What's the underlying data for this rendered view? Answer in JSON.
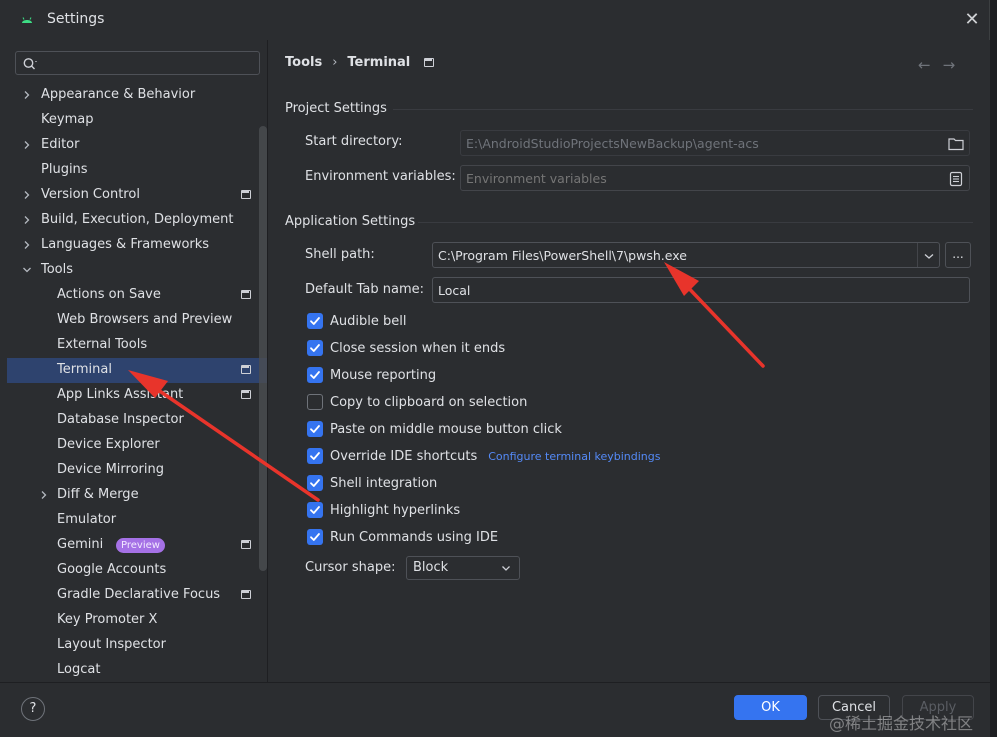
{
  "window": {
    "title": "Settings",
    "close_label": "✕"
  },
  "search": {
    "placeholder": "",
    "value": ""
  },
  "sidebar": {
    "items": [
      {
        "label": "Appearance & Behavior",
        "level": 0,
        "expandable": true,
        "expanded": false,
        "project": false
      },
      {
        "label": "Keymap",
        "level": 0,
        "expandable": false,
        "project": false
      },
      {
        "label": "Editor",
        "level": 0,
        "expandable": true,
        "expanded": false,
        "project": false
      },
      {
        "label": "Plugins",
        "level": 0,
        "expandable": false,
        "project": false
      },
      {
        "label": "Version Control",
        "level": 0,
        "expandable": true,
        "expanded": false,
        "project": true
      },
      {
        "label": "Build, Execution, Deployment",
        "level": 0,
        "expandable": true,
        "expanded": false,
        "project": false
      },
      {
        "label": "Languages & Frameworks",
        "level": 0,
        "expandable": true,
        "expanded": false,
        "project": false
      },
      {
        "label": "Tools",
        "level": 0,
        "expandable": true,
        "expanded": true,
        "project": false
      },
      {
        "label": "Actions on Save",
        "level": 1,
        "expandable": false,
        "project": true
      },
      {
        "label": "Web Browsers and Preview",
        "level": 1,
        "expandable": false,
        "project": false
      },
      {
        "label": "External Tools",
        "level": 1,
        "expandable": false,
        "project": false
      },
      {
        "label": "Terminal",
        "level": 1,
        "expandable": false,
        "project": true,
        "selected": true
      },
      {
        "label": "App Links Assistant",
        "level": 1,
        "expandable": false,
        "project": true
      },
      {
        "label": "Database Inspector",
        "level": 1,
        "expandable": false,
        "project": false
      },
      {
        "label": "Device Explorer",
        "level": 1,
        "expandable": false,
        "project": false
      },
      {
        "label": "Device Mirroring",
        "level": 1,
        "expandable": false,
        "project": false
      },
      {
        "label": "Diff & Merge",
        "level": 1,
        "expandable": true,
        "expanded": false,
        "project": false
      },
      {
        "label": "Emulator",
        "level": 1,
        "expandable": false,
        "project": false
      },
      {
        "label": "Gemini",
        "level": 1,
        "expandable": false,
        "project": true,
        "badge": "Preview"
      },
      {
        "label": "Google Accounts",
        "level": 1,
        "expandable": false,
        "project": false
      },
      {
        "label": "Gradle Declarative Focus",
        "level": 1,
        "expandable": false,
        "project": true
      },
      {
        "label": "Key Promoter X",
        "level": 1,
        "expandable": false,
        "project": false
      },
      {
        "label": "Layout Inspector",
        "level": 1,
        "expandable": false,
        "project": false
      },
      {
        "label": "Logcat",
        "level": 1,
        "expandable": false,
        "project": false
      }
    ]
  },
  "breadcrumb": {
    "parent": "Tools",
    "separator": "›",
    "current": "Terminal"
  },
  "nav": {
    "back": "←",
    "forward": "→"
  },
  "project_settings": {
    "title": "Project Settings",
    "start_directory_label": "Start directory:",
    "start_directory_value": "E:\\AndroidStudioProjectsNewBackup\\agent-acs",
    "env_vars_label": "Environment variables:",
    "env_vars_placeholder": "Environment variables"
  },
  "app_settings": {
    "title": "Application Settings",
    "shell_path_label": "Shell path:",
    "shell_path_value": "C:\\Program Files\\PowerShell\\7\\pwsh.exe",
    "browse_label": "...",
    "tab_name_label": "Default Tab name:",
    "tab_name_value": "Local",
    "options": [
      {
        "label": "Audible bell",
        "checked": true
      },
      {
        "label": "Close session when it ends",
        "checked": true
      },
      {
        "label": "Mouse reporting",
        "checked": true
      },
      {
        "label": "Copy to clipboard on selection",
        "checked": false
      },
      {
        "label": "Paste on middle mouse button click",
        "checked": true
      },
      {
        "label": "Override IDE shortcuts",
        "checked": true,
        "link": "Configure terminal keybindings"
      },
      {
        "label": "Shell integration",
        "checked": true
      },
      {
        "label": "Highlight hyperlinks",
        "checked": true
      },
      {
        "label": "Run Commands using IDE",
        "checked": true
      }
    ],
    "cursor_shape_label": "Cursor shape:",
    "cursor_shape_value": "Block"
  },
  "footer": {
    "help_label": "?",
    "ok_label": "OK",
    "cancel_label": "Cancel",
    "apply_label": "Apply",
    "watermark": "@稀土掘金技术社区"
  },
  "colors": {
    "accent": "#3574f0",
    "selection": "#2e436e",
    "badge": "#a571e6",
    "link": "#548af7",
    "annotation_arrow": "#e8342b",
    "background": "#2b2d30"
  }
}
